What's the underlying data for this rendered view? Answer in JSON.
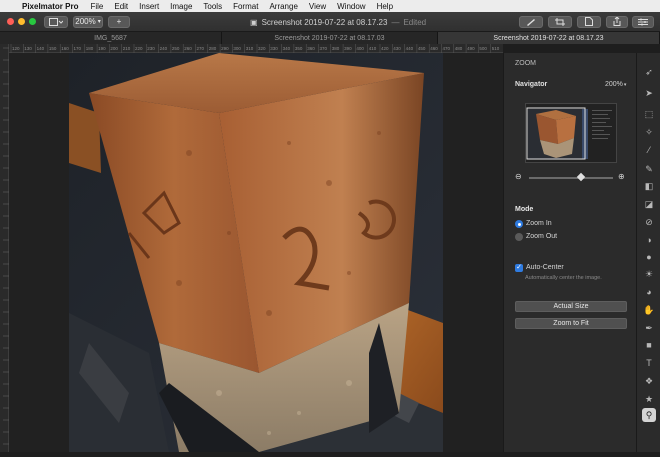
{
  "menubar": {
    "apple": "",
    "app_name": "Pixelmator Pro",
    "items": [
      "File",
      "Edit",
      "Insert",
      "Image",
      "Tools",
      "Format",
      "Arrange",
      "View",
      "Window",
      "Help"
    ]
  },
  "toolbar": {
    "zoom_value": "200%",
    "add_label": "+",
    "doc_title": "Screenshot 2019-07-22 at 08.17.23",
    "title_separator": "—",
    "edited_label": "Edited"
  },
  "tabs": [
    {
      "label": "IMG_5687",
      "active": false
    },
    {
      "label": "Screenshot 2019-07-22 at 08.17.03",
      "active": false
    },
    {
      "label": "Screenshot 2019-07-22 at 08.17.23",
      "active": true
    }
  ],
  "ruler": {
    "ticks": [
      "120",
      "130",
      "140",
      "150",
      "160",
      "170",
      "180",
      "190",
      "200",
      "210",
      "220",
      "230",
      "240",
      "250",
      "260",
      "270",
      "280",
      "290",
      "300",
      "310",
      "320",
      "330",
      "340",
      "350",
      "360",
      "370",
      "380",
      "390",
      "400",
      "410",
      "420",
      "430",
      "440",
      "450",
      "460",
      "470",
      "480",
      "490",
      "500",
      "510"
    ]
  },
  "panel": {
    "header": "ZOOM",
    "navigator_label": "Navigator",
    "navigator_zoom": "200%",
    "mode_label": "Mode",
    "zoom_in_label": "Zoom In",
    "zoom_out_label": "Zoom Out",
    "selected_mode": "Zoom In",
    "auto_center_label": "Auto-Center",
    "auto_center_checked": true,
    "auto_center_desc": "Automatically center the image.",
    "actual_size_label": "Actual Size",
    "zoom_to_fit_label": "Zoom to Fit",
    "slider_level": 0.62
  },
  "colors": {
    "accent": "#2f7be0",
    "close": "#ff5f57",
    "minimize": "#febc2e",
    "zoom": "#28c840"
  },
  "tools": [
    "arrange-icon",
    "select-icon",
    "marquee-icon",
    "magic-wand-icon",
    "color-picker-icon",
    "paint-brush-icon",
    "fill-icon",
    "eraser-icon",
    "retouch-icon",
    "color-adjust-icon",
    "sharpen-icon",
    "light-icon",
    "smudge-icon",
    "warp-icon",
    "pen-icon",
    "shape-icon",
    "type-icon",
    "style-icon",
    "effects-icon",
    "zoom-icon"
  ]
}
